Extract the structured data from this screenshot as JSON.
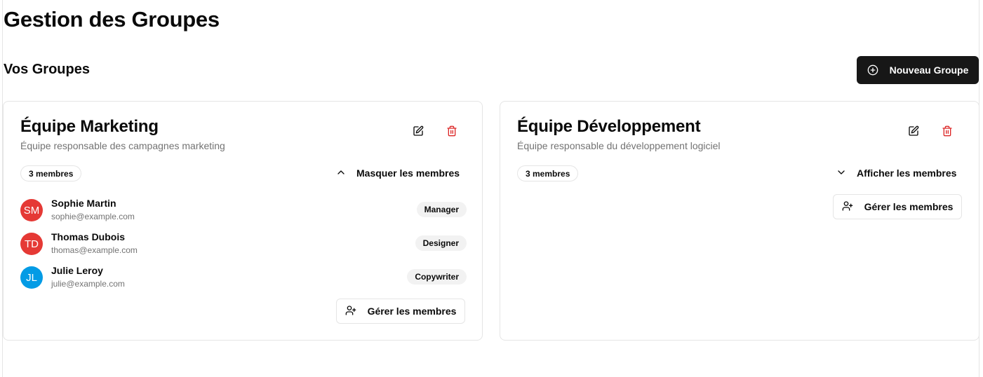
{
  "page": {
    "title": "Gestion des Groupes"
  },
  "section": {
    "title": "Vos Groupes",
    "new_group_label": "Nouveau Groupe"
  },
  "colors": {
    "primary": "#171717",
    "danger": "#dc2626",
    "muted": "#737373",
    "border": "#e5e5e5"
  },
  "groups": [
    {
      "title": "Équipe Marketing",
      "description": "Équipe responsable des campagnes marketing",
      "member_count": "3 membres",
      "toggle_label": "Masquer les membres",
      "toggle_icon": "chevron-up-icon",
      "expanded": true,
      "manage_label": "Gérer les membres",
      "members": [
        {
          "initials": "SM",
          "name": "Sophie Martin",
          "email": "sophie@example.com",
          "role": "Manager",
          "avatar_color": "#e53935"
        },
        {
          "initials": "TD",
          "name": "Thomas Dubois",
          "email": "thomas@example.com",
          "role": "Designer",
          "avatar_color": "#e53935"
        },
        {
          "initials": "JL",
          "name": "Julie Leroy",
          "email": "julie@example.com",
          "role": "Copywriter",
          "avatar_color": "#039be5"
        }
      ]
    },
    {
      "title": "Équipe Développement",
      "description": "Équipe responsable du développement logiciel",
      "member_count": "3 membres",
      "toggle_label": "Afficher les membres",
      "toggle_icon": "chevron-down-icon",
      "expanded": false,
      "manage_label": "Gérer les membres"
    }
  ]
}
